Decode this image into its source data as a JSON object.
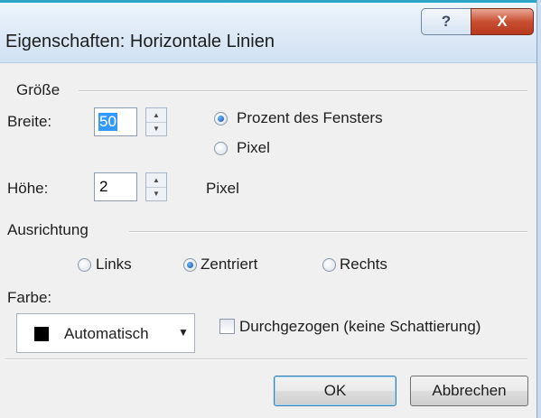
{
  "window": {
    "title": "Eigenschaften: Horizontale Linien",
    "help_symbol": "?",
    "close_symbol": "X"
  },
  "size": {
    "heading": "Größe",
    "width_label": "Breite:",
    "width_value": "50",
    "height_label": "Höhe:",
    "height_value": "2",
    "unit_options": [
      {
        "label": "Prozent des Fensters",
        "selected": true
      },
      {
        "label": "Pixel",
        "selected": false
      }
    ],
    "height_unit": "Pixel"
  },
  "alignment": {
    "heading": "Ausrichtung",
    "options": [
      {
        "label": "Links",
        "selected": false
      },
      {
        "label": "Zentriert",
        "selected": true
      },
      {
        "label": "Rechts",
        "selected": false
      }
    ]
  },
  "color": {
    "label": "Farbe:",
    "value": "Automatisch",
    "swatch": "#000000"
  },
  "solid_checkbox": {
    "label": "Durchgezogen (keine Schattierung)",
    "checked": false
  },
  "buttons": {
    "ok": "OK",
    "cancel": "Abbrechen"
  }
}
